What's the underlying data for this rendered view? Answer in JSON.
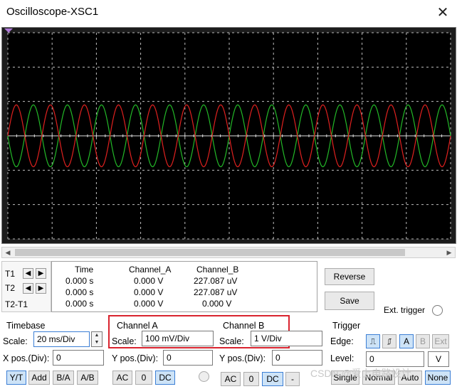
{
  "window": {
    "title": "Oscilloscope-XSC1"
  },
  "screen": {
    "background": "#000000",
    "grid_color": "#bdbdbd",
    "channel_a_color": "#e0211f",
    "channel_b_color": "#23b928",
    "channel_a_cycles": 13,
    "channel_b_cycles": 13,
    "channel_a_amplitude_divs": 0.9,
    "channel_b_amplitude_divs": 0.9
  },
  "cursors": {
    "t1": "T1",
    "t2": "T2",
    "t2t1": "T2-T1"
  },
  "readout": {
    "headers": [
      "Time",
      "Channel_A",
      "Channel_B"
    ],
    "rows": [
      [
        "0.000 s",
        "0.000 V",
        "227.087 uV"
      ],
      [
        "0.000 s",
        "0.000 V",
        "227.087 uV"
      ],
      [
        "0.000 s",
        "0.000 V",
        "0.000 V"
      ]
    ]
  },
  "buttons": {
    "reverse": "Reverse",
    "save": "Save",
    "ext_trigger": "Ext. trigger"
  },
  "timebase": {
    "title": "Timebase",
    "scale_label": "Scale:",
    "scale_value": "20 ms/Div",
    "xpos_label": "X pos.(Div):",
    "xpos_value": "0",
    "modes": [
      "Y/T",
      "Add",
      "B/A",
      "A/B"
    ]
  },
  "channel_a": {
    "title": "Channel A",
    "scale_label": "Scale:",
    "scale_value": "100 mV/Div",
    "ypos_label": "Y pos.(Div):",
    "ypos_value": "0",
    "coupling": [
      "AC",
      "0",
      "DC"
    ]
  },
  "channel_b": {
    "title": "Channel B",
    "scale_label": "Scale:",
    "scale_value": "1  V/Div",
    "ypos_label": "Y pos.(Div):",
    "ypos_value": "0",
    "coupling": [
      "AC",
      "0",
      "DC",
      "-"
    ]
  },
  "trigger": {
    "title": "Trigger",
    "edge_label": "Edge:",
    "edge_sources": [
      "A",
      "B",
      "Ext"
    ],
    "level_label": "Level:",
    "level_value": "0",
    "level_unit": "V",
    "modes": [
      "Single",
      "Normal",
      "Auto",
      "None"
    ]
  },
  "watermark": "CSDN @爱上电路设计"
}
